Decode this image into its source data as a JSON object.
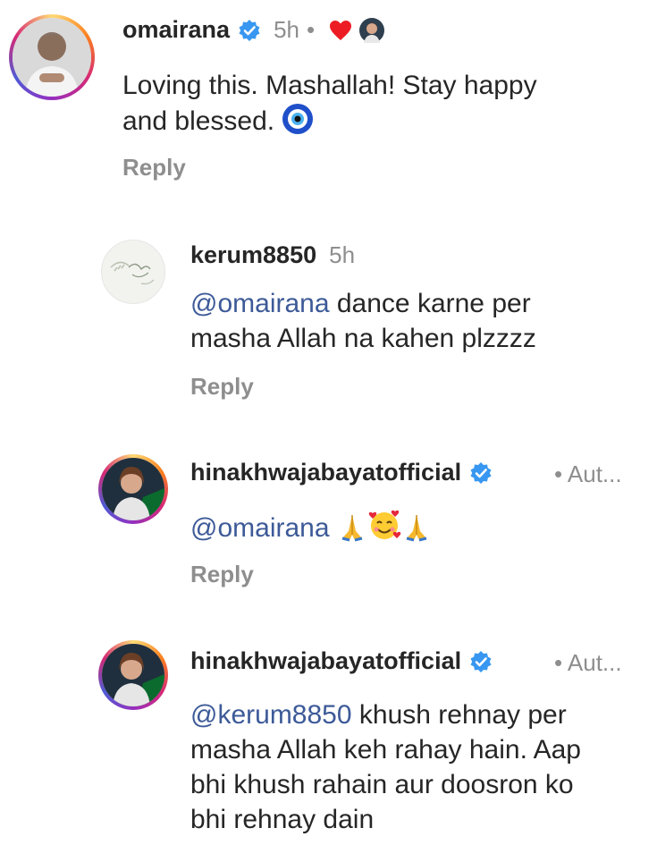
{
  "comments": [
    {
      "username": "omairana",
      "verified": true,
      "time": "5h",
      "separator": "•",
      "text": "Loving this. Mashallah! Stay happy\nand blessed.",
      "emoji_icons": [
        "nazar-amulet-icon"
      ],
      "liked_by_author": true,
      "reply_label": "Reply"
    },
    {
      "username": "kerum8850",
      "verified": false,
      "time": "5h",
      "mention": "@omairana",
      "text": " dance karne per\nmasha Allah na kahen plzzzz",
      "reply_label": "Reply"
    },
    {
      "username": "hinakhwajabayatofficial",
      "verified": true,
      "author_tag": "• Aut...",
      "mention": "@omairana",
      "emoji_icons": [
        "folded-hands-icon",
        "smiling-face-with-hearts-icon",
        "folded-hands-icon"
      ],
      "reply_label": "Reply"
    },
    {
      "username": "hinakhwajabayatofficial",
      "verified": true,
      "author_tag": "• Aut...",
      "mention": "@kerum8850",
      "text": " khush rehnay per\nmasha Allah keh rahay hain. Aap\nbhi khush rahain aur doosron ko\nbhi rehnay dain"
    }
  ],
  "colors": {
    "verified_blue": "#3897f0",
    "mention_blue": "#3d5a98",
    "heart_red": "#ed1c24",
    "muted_gray": "#8e8e8e"
  }
}
